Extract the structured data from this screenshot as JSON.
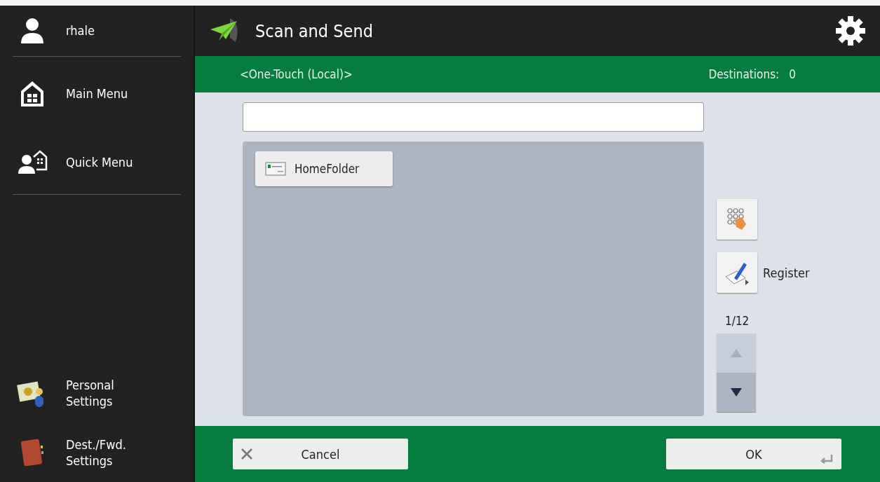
{
  "sidebar": {
    "user": "rhale",
    "top_items": [
      {
        "label": "Main Menu",
        "kind": "home"
      },
      {
        "label": "Quick Menu",
        "kind": "quick"
      }
    ],
    "bottom_items": [
      {
        "label": "Personal\nSettings",
        "kind": "personal"
      },
      {
        "label": "Dest./Fwd.\nSettings",
        "kind": "book"
      }
    ]
  },
  "header": {
    "title": "Scan and Send"
  },
  "subheader": {
    "address_book": "<One-Touch (Local)>",
    "destinations_label": "Destinations:",
    "destinations_count": "0"
  },
  "destinations": [
    {
      "label": "HomeFolder"
    }
  ],
  "side_buttons": {
    "register": "Register",
    "page": "1/12",
    "page_up_disabled": true,
    "page_down_disabled": false
  },
  "footer": {
    "cancel": "Cancel",
    "ok": "OK"
  }
}
